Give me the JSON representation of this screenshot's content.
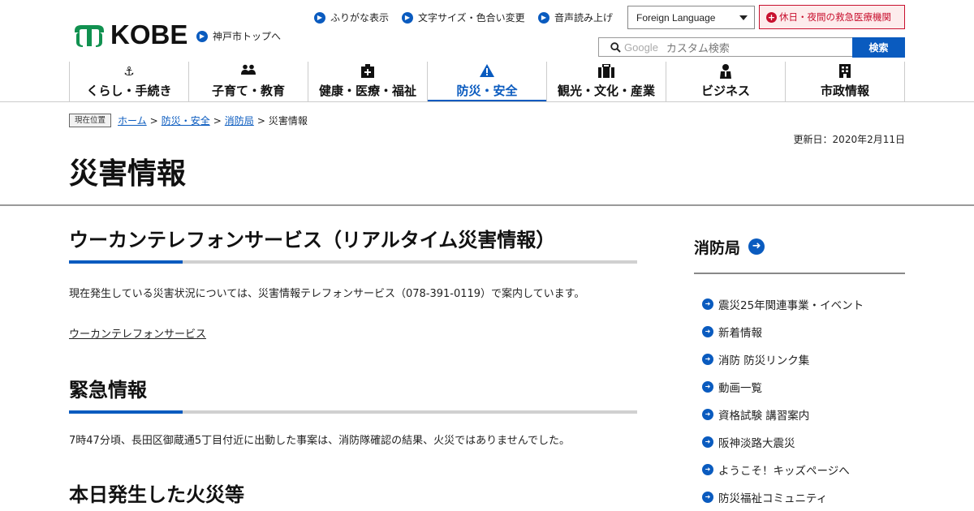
{
  "header": {
    "logo_text": "KOBE",
    "top_link": "神戸市トップへ",
    "utilities": [
      "ふりがな表示",
      "文字サイズ・色合い変更",
      "音声読み上げ"
    ],
    "language_select": "Foreign Language",
    "emergency": "休日・夜間の救急医療機関",
    "search_brand": "Google",
    "search_placeholder": "カスタム検索",
    "search_button": "検索"
  },
  "nav": {
    "items": [
      {
        "label": "くらし・手続き",
        "icon": "anchor-icon"
      },
      {
        "label": "子育て・教育",
        "icon": "people-icon"
      },
      {
        "label": "健康・医療・福祉",
        "icon": "hospital-icon"
      },
      {
        "label": "防災・安全",
        "icon": "warning-icon"
      },
      {
        "label": "観光・文化・産業",
        "icon": "suitcase-icon"
      },
      {
        "label": "ビジネス",
        "icon": "person-icon"
      },
      {
        "label": "市政情報",
        "icon": "building-icon"
      }
    ],
    "active_index": 3
  },
  "breadcrumb": {
    "tag": "現在位置",
    "links": [
      "ホーム",
      "防災・安全",
      "消防局"
    ],
    "current": "災害情報",
    "separator": ">"
  },
  "updated": "更新日：2020年2月11日",
  "page_title": "災害情報",
  "main": {
    "section1": {
      "heading": "ウーカンテレフォンサービス（リアルタイム災害情報）",
      "text": "現在発生している災害状況については、災害情報テレフォンサービス（078-391-0119）で案内しています。",
      "link": "ウーカンテレフォンサービス"
    },
    "section2": {
      "heading": "緊急情報",
      "text": "7時47分頃、長田区御蔵通5丁目付近に出動した事案は、消防隊確認の結果、火災ではありませんでした。"
    },
    "section3": {
      "heading": "本日発生した火災等"
    }
  },
  "side": {
    "heading": "消防局",
    "items": [
      "震災25年関連事業・イベント",
      "新着情報",
      "消防 防災リンク集",
      "動画一覧",
      "資格試験 講習案内",
      "阪神淡路大震災",
      "ようこそ！キッズページへ",
      "防災福祉コミュニティ"
    ]
  },
  "colors": {
    "accent": "#0a5bbf",
    "emergency": "#c8102e"
  }
}
